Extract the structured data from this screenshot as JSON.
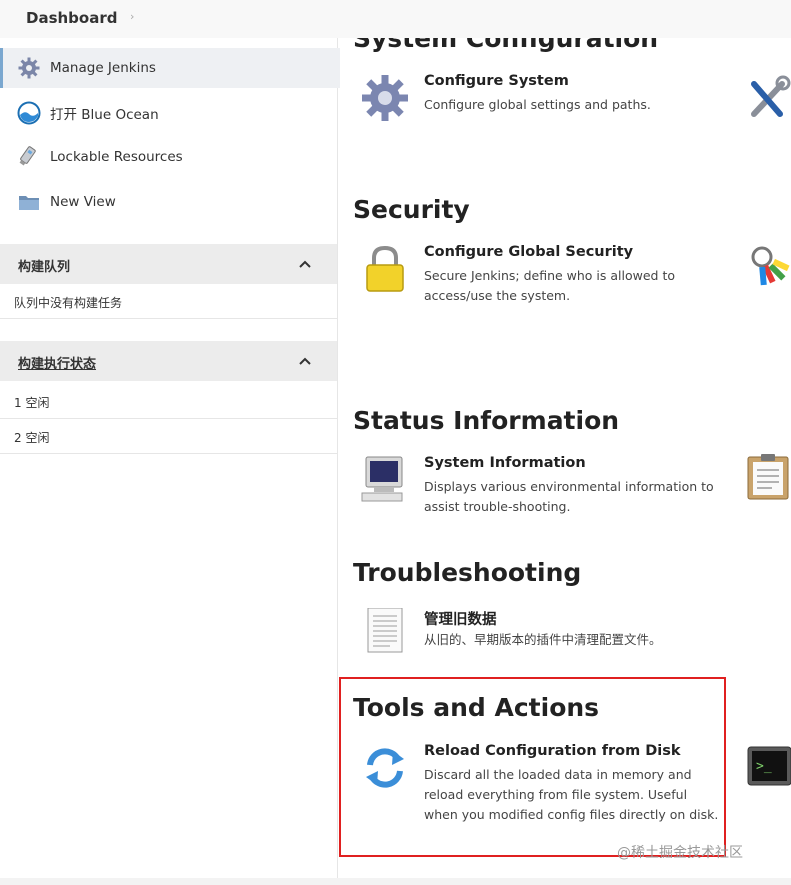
{
  "breadcrumb": {
    "dashboard": "Dashboard",
    "sep": "›"
  },
  "sidebar": {
    "items": [
      {
        "label": "Manage Jenkins",
        "icon": "gear-icon"
      },
      {
        "label": "打开 Blue Ocean",
        "icon": "blue-ocean-icon"
      },
      {
        "label": "Lockable Resources",
        "icon": "usb-drive-icon"
      },
      {
        "label": "New View",
        "icon": "folder-icon"
      }
    ],
    "build_queue": {
      "title": "构建队列",
      "empty_text": "队列中没有构建任务"
    },
    "executors": {
      "title": "构建执行状态",
      "rows": [
        "1  空闲",
        "2  空闲"
      ]
    }
  },
  "sections": [
    {
      "title": "System Configuration",
      "item": {
        "name": "Configure System",
        "desc": "Configure global settings and paths.",
        "icon": "gear-icon"
      },
      "right_icon": "tools-icon"
    },
    {
      "title": "Security",
      "item": {
        "name": "Configure Global Security",
        "desc": "Secure Jenkins; define who is allowed to access/use the system.",
        "icon": "lock-icon"
      },
      "right_icon": "keys-icon"
    },
    {
      "title": "Status Information",
      "item": {
        "name": "System Information",
        "desc": "Displays various environmental information to assist trouble-shooting.",
        "icon": "computer-icon"
      },
      "right_icon": "clipboard-icon"
    },
    {
      "title": "Troubleshooting",
      "item": {
        "name": "管理旧数据",
        "desc": "从旧的、早期版本的插件中清理配置文件。",
        "icon": "document-icon"
      }
    },
    {
      "title": "Tools and Actions",
      "item": {
        "name": "Reload Configuration from Disk",
        "desc": "Discard all the loaded data in memory and reload everything from file system. Useful when you modified config files directly on disk.",
        "icon": "reload-icon"
      },
      "right_icon": "terminal-icon"
    }
  ],
  "watermark": "@稀土掘金技术社区",
  "colors": {
    "highlight": "#e02020",
    "active_border": "#7aa7cf"
  }
}
